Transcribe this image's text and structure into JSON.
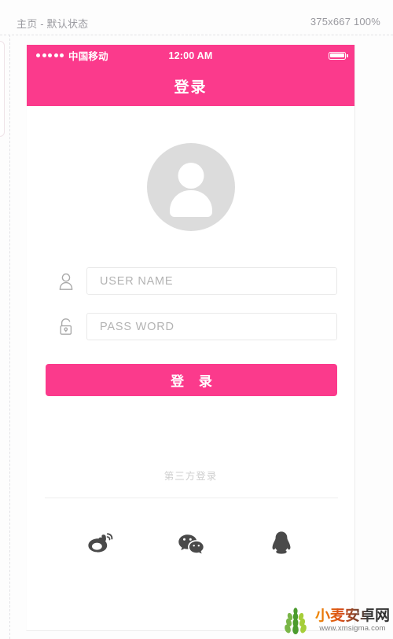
{
  "editor": {
    "artboard_label": "主页 - 默认状态",
    "artboard_size": "375x667 100%"
  },
  "phone": {
    "status_bar": {
      "signal_dots": 5,
      "carrier": "中国移动",
      "time": "12:00 AM",
      "battery_icon": "battery-full-icon"
    },
    "navbar": {
      "title": "登录",
      "background": "#fb3a8c"
    },
    "avatar": {
      "icon": "user-avatar-placeholder",
      "circle_color": "#dcdcdc",
      "glyph_color": "#ffffff"
    },
    "form": {
      "username": {
        "icon": "user-icon",
        "placeholder": "USER NAME",
        "value": ""
      },
      "password": {
        "icon": "unlock-icon",
        "placeholder": "PASS WORD",
        "value": ""
      }
    },
    "login_button": {
      "label": "登 录",
      "background": "#fb3a8c",
      "text_color": "#ffffff"
    },
    "third_party": {
      "label": "第三方登录",
      "items": [
        {
          "name": "weibo",
          "icon": "weibo-icon"
        },
        {
          "name": "wechat",
          "icon": "wechat-icon"
        },
        {
          "name": "qq",
          "icon": "qq-icon"
        }
      ]
    }
  },
  "watermark": {
    "title": "小麦安卓网",
    "url": "www.xmsigma.com",
    "logo_icon": "wheat-logo-icon"
  }
}
